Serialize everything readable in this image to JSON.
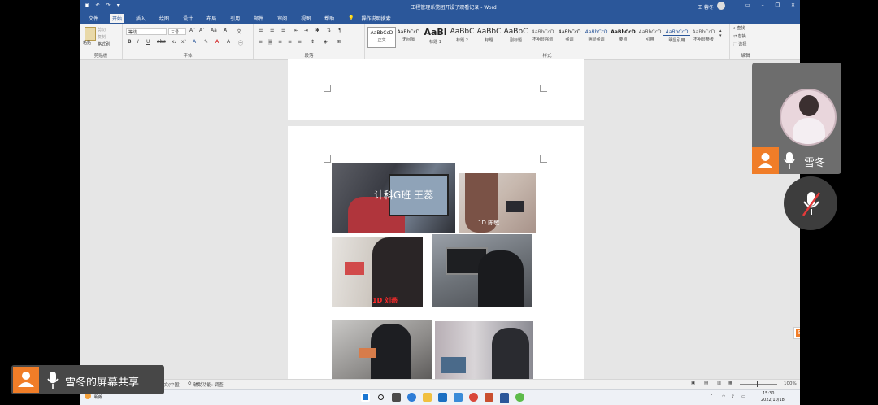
{
  "word": {
    "title": "工程管理系党团开设了观看记录 - Word",
    "user": "王 蓉冬",
    "tabs": [
      "文件",
      "开始",
      "插入",
      "绘图",
      "设计",
      "布局",
      "引用",
      "邮件",
      "审阅",
      "视图",
      "帮助"
    ],
    "active_tab": "开始",
    "tell_me": "操作说明搜索",
    "clipboard": {
      "paste": "粘贴",
      "cut": "剪切",
      "copy": "复制",
      "format_painter": "格式刷",
      "group": "剪贴板"
    },
    "font": {
      "name": "等线",
      "size": "三号",
      "group": "字体"
    },
    "paragraph_group": "段落",
    "styles": [
      {
        "preview": "AaBbCcD",
        "name": "正文"
      },
      {
        "preview": "AaBbCcD",
        "name": "无间隔"
      },
      {
        "preview": "AaBl",
        "name": "标题 1"
      },
      {
        "preview": "AaBbC",
        "name": "标题 2"
      },
      {
        "preview": "AaBbC",
        "name": "标题"
      },
      {
        "preview": "AaBbC",
        "name": "副标题"
      },
      {
        "preview": "AaBbCcD",
        "name": "不明显强调"
      },
      {
        "preview": "AaBbCcD",
        "name": "强调"
      },
      {
        "preview": "AaBbCcD",
        "name": "明显强调"
      },
      {
        "preview": "AaBbCcD",
        "name": "要点"
      },
      {
        "preview": "AaBbCcD",
        "name": "引用"
      },
      {
        "preview": "AaBbCcD",
        "name": "明显引用"
      },
      {
        "preview": "AaBbCcD",
        "name": "不明显参考"
      }
    ],
    "styles_group": "样式",
    "editing": {
      "find": "查找",
      "replace": "替换",
      "select": "选择",
      "group": "编辑"
    },
    "status": {
      "language": "中文(中国)",
      "accessibility": "辅助功能: 调查",
      "zoom": "100%"
    },
    "taskbar": {
      "weather": "明朗",
      "time": "15:30",
      "date": "2022/10/18"
    }
  },
  "photos": [
    {
      "caption": "计科G班 王蕊"
    },
    {
      "caption": "1D 陈敏"
    },
    {
      "caption": "1D 刘燕"
    }
  ],
  "meeting": {
    "speaker_name": "雪冬",
    "share_label": "雪冬的屏幕共享"
  },
  "colors": {
    "word_blue": "#2b579a",
    "accent_orange": "#f07d28",
    "caption_red": "#ff2a2a"
  }
}
